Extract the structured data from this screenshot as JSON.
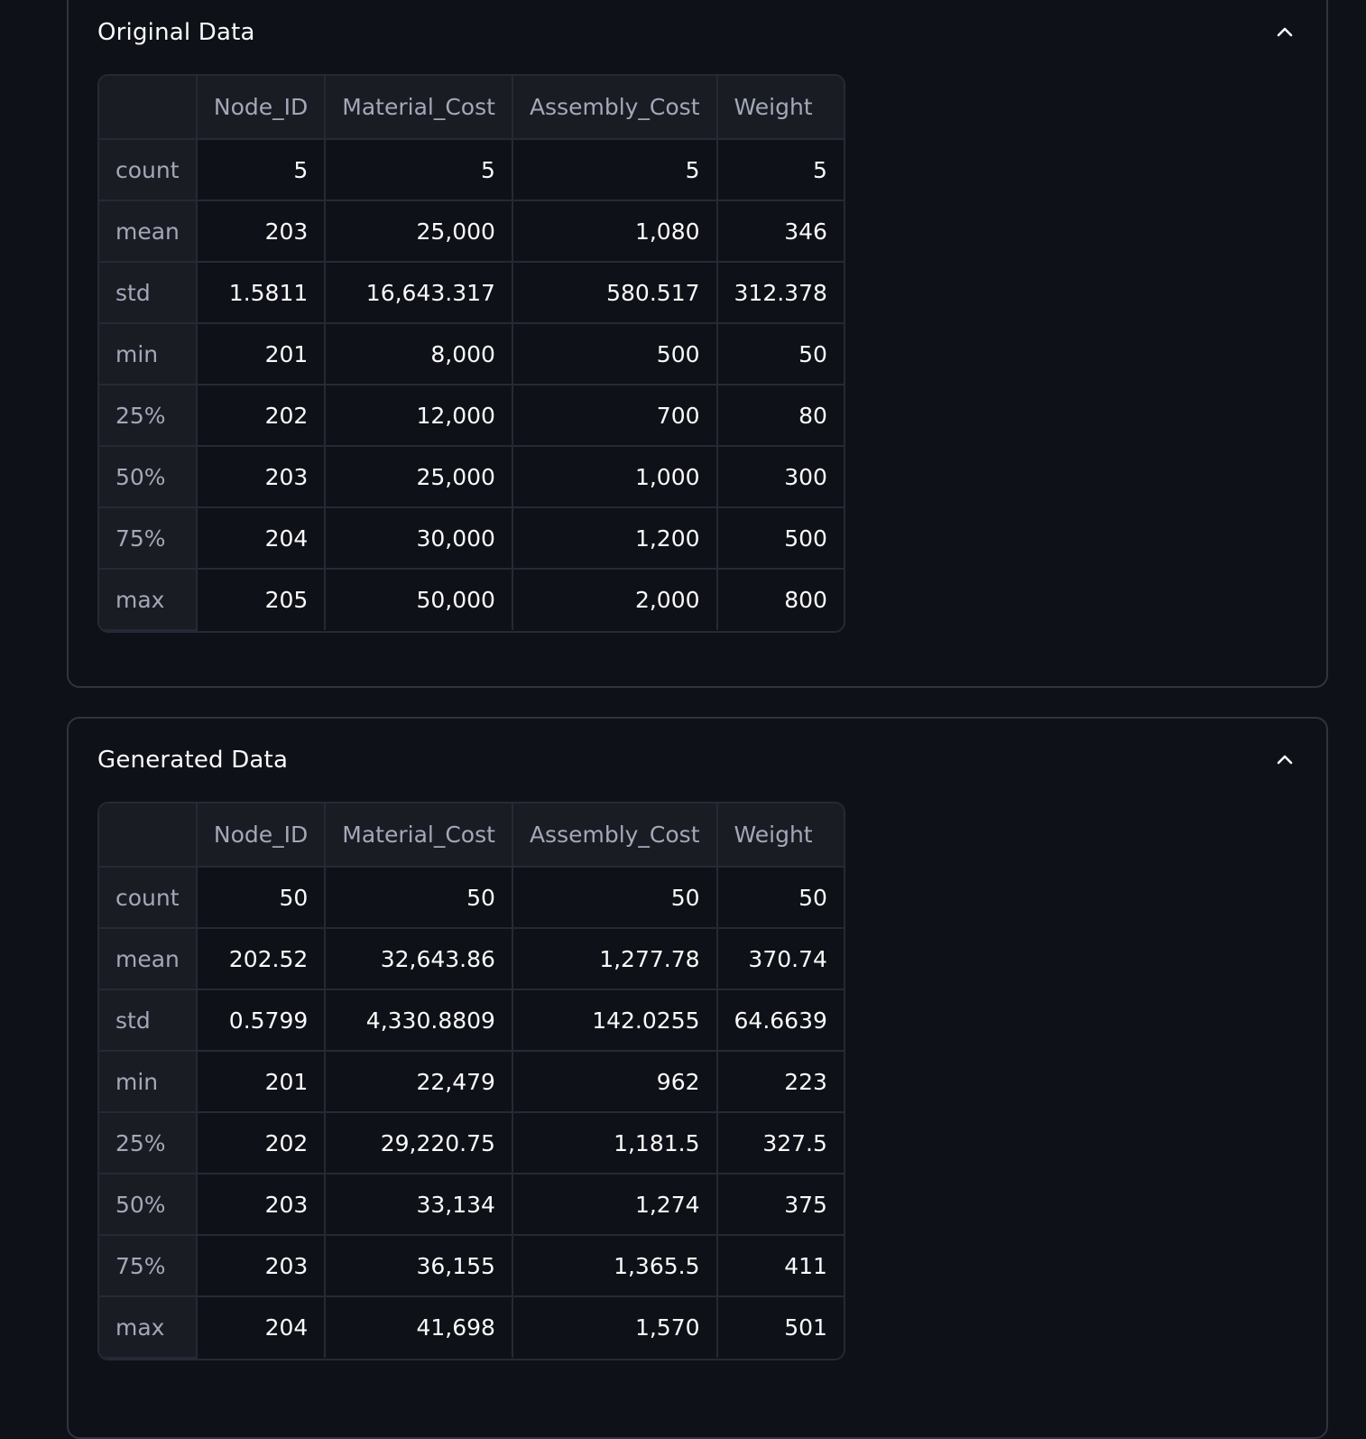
{
  "panels": [
    {
      "title": "Original Data",
      "columns": [
        "",
        "Node_ID",
        "Material_Cost",
        "Assembly_Cost",
        "Weight"
      ],
      "rows": [
        [
          "count",
          "5",
          "5",
          "5",
          "5"
        ],
        [
          "mean",
          "203",
          "25,000",
          "1,080",
          "346"
        ],
        [
          "std",
          "1.5811",
          "16,643.317",
          "580.517",
          "312.378"
        ],
        [
          "min",
          "201",
          "8,000",
          "500",
          "50"
        ],
        [
          "25%",
          "202",
          "12,000",
          "700",
          "80"
        ],
        [
          "50%",
          "203",
          "25,000",
          "1,000",
          "300"
        ],
        [
          "75%",
          "204",
          "30,000",
          "1,200",
          "500"
        ],
        [
          "max",
          "205",
          "50,000",
          "2,000",
          "800"
        ]
      ]
    },
    {
      "title": "Generated Data",
      "columns": [
        "",
        "Node_ID",
        "Material_Cost",
        "Assembly_Cost",
        "Weight"
      ],
      "rows": [
        [
          "count",
          "50",
          "50",
          "50",
          "50"
        ],
        [
          "mean",
          "202.52",
          "32,643.86",
          "1,277.78",
          "370.74"
        ],
        [
          "std",
          "0.5799",
          "4,330.8809",
          "142.0255",
          "64.6639"
        ],
        [
          "min",
          "201",
          "22,479",
          "962",
          "223"
        ],
        [
          "25%",
          "202",
          "29,220.75",
          "1,181.5",
          "327.5"
        ],
        [
          "50%",
          "203",
          "33,134",
          "1,274",
          "375"
        ],
        [
          "75%",
          "203",
          "36,155",
          "1,365.5",
          "411"
        ],
        [
          "max",
          "204",
          "41,698",
          "1,570",
          "501"
        ]
      ]
    }
  ],
  "icons": {
    "collapse": "chevron-up-icon"
  },
  "colors": {
    "background": "#0e1117",
    "border": "#31333f",
    "header_bg": "#1a1c24",
    "muted_text": "#a3a8b8"
  }
}
